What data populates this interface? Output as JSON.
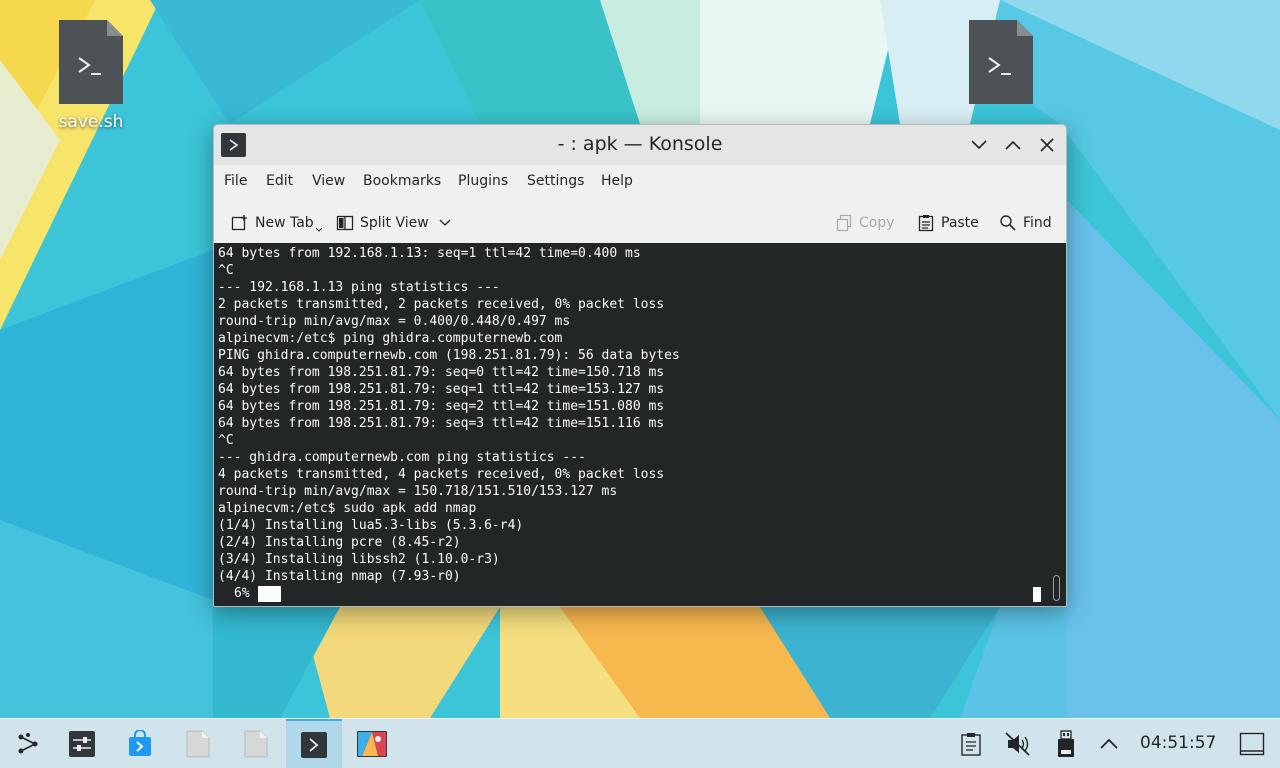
{
  "desktop": {
    "icons": [
      {
        "label": "save.sh",
        "icon": "shell-script-icon"
      },
      {
        "label": "",
        "icon": "shell-script-icon"
      }
    ]
  },
  "window": {
    "title": "- : apk — Konsole",
    "app_icon": "konsole-icon",
    "menu": [
      "File",
      "Edit",
      "View",
      "Bookmarks",
      "Plugins",
      "Settings",
      "Help"
    ],
    "toolbar": {
      "new_tab": "New Tab",
      "split_view": "Split View",
      "copy": "Copy",
      "paste": "Paste",
      "find": "Find"
    },
    "terminal": {
      "lines": [
        "64 bytes from 192.168.1.13: seq=1 ttl=42 time=0.400 ms",
        "^C",
        "--- 192.168.1.13 ping statistics ---",
        "2 packets transmitted, 2 packets received, 0% packet loss",
        "round-trip min/avg/max = 0.400/0.448/0.497 ms",
        "alpinecvm:/etc$ ping ghidra.computernewb.com",
        "PING ghidra.computernewb.com (198.251.81.79): 56 data bytes",
        "64 bytes from 198.251.81.79: seq=0 ttl=42 time=150.718 ms",
        "64 bytes from 198.251.81.79: seq=1 ttl=42 time=153.127 ms",
        "64 bytes from 198.251.81.79: seq=2 ttl=42 time=151.080 ms",
        "64 bytes from 198.251.81.79: seq=3 ttl=42 time=151.116 ms",
        "^C",
        "--- ghidra.computernewb.com ping statistics ---",
        "4 packets transmitted, 4 packets received, 0% packet loss",
        "round-trip min/avg/max = 150.718/151.510/153.127 ms",
        "alpinecvm:/etc$ sudo apk add nmap",
        "(1/4) Installing lua5.3-libs (5.3.6-r4)",
        "(2/4) Installing pcre (8.45-r2)",
        "(3/4) Installing libssh2 (1.10.0-r3)",
        "(4/4) Installing nmap (7.93-r0)"
      ],
      "progress_label": "6%",
      "progress_fraction": 0.06
    }
  },
  "taskbar": {
    "launcher": "application-launcher-icon",
    "tasks": [
      {
        "name": "system-settings-icon"
      },
      {
        "name": "discover-icon"
      },
      {
        "name": "file-icon"
      },
      {
        "name": "file-icon"
      },
      {
        "name": "konsole-icon",
        "active": true
      },
      {
        "name": "image-viewer-icon"
      }
    ],
    "tray": [
      "clipboard-icon",
      "volume-muted-icon",
      "usb-drive-icon",
      "expand-tray-icon"
    ],
    "clock": "04:51:57",
    "show_desktop": "show-desktop-icon"
  }
}
